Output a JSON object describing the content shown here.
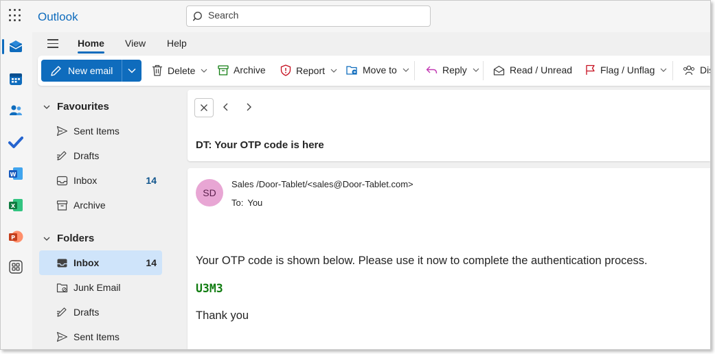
{
  "app": {
    "title": "Outlook"
  },
  "search": {
    "placeholder": "Search"
  },
  "rail": {
    "apps": [
      {
        "name": "mail-icon",
        "color": "#0f6cbd"
      },
      {
        "name": "calendar-icon",
        "color": "#0f6cbd"
      },
      {
        "name": "people-icon",
        "color": "#0f6cbd"
      },
      {
        "name": "todo-icon",
        "color": "#2564cf"
      },
      {
        "name": "word-icon",
        "color": "#185abd"
      },
      {
        "name": "excel-icon",
        "color": "#107c41"
      },
      {
        "name": "powerpoint-icon",
        "color": "#c43e1c"
      },
      {
        "name": "more-apps-icon",
        "color": "#424242"
      }
    ]
  },
  "tabs": [
    {
      "label": "Home",
      "active": true
    },
    {
      "label": "View",
      "active": false
    },
    {
      "label": "Help",
      "active": false
    }
  ],
  "toolbar": {
    "new_email": "New email",
    "delete": "Delete",
    "archive": "Archive",
    "report": "Report",
    "move_to": "Move to",
    "reply": "Reply",
    "read_unread": "Read / Unread",
    "flag_unflag": "Flag / Unflag",
    "overflow_partial": "Dis"
  },
  "folders": {
    "favourites_label": "Favourites",
    "favourites": [
      {
        "label": "Sent Items",
        "count": ""
      },
      {
        "label": "Drafts",
        "count": ""
      },
      {
        "label": "Inbox",
        "count": "14"
      },
      {
        "label": "Archive",
        "count": ""
      }
    ],
    "folders_label": "Folders",
    "items": [
      {
        "label": "Inbox",
        "count": "14",
        "selected": true
      },
      {
        "label": "Junk Email",
        "count": ""
      },
      {
        "label": "Drafts",
        "count": ""
      },
      {
        "label": "Sent Items",
        "count": ""
      }
    ]
  },
  "reading": {
    "subject": "DT: Your OTP code is here",
    "avatar_initials": "SD",
    "sender": "Sales /Door-Tablet/<sales@Door-Tablet.com>",
    "to_label": "To:",
    "to_value": "You",
    "body": "Your OTP code is shown below. Please use it now to complete the authentication process.",
    "otp": "U3M3",
    "closing": "Thank you"
  },
  "colors": {
    "accent": "#0f6cbd",
    "otp": "#107c10",
    "selected_folder": "#cfe4fa",
    "avatar_bg": "#e8a6d4"
  }
}
